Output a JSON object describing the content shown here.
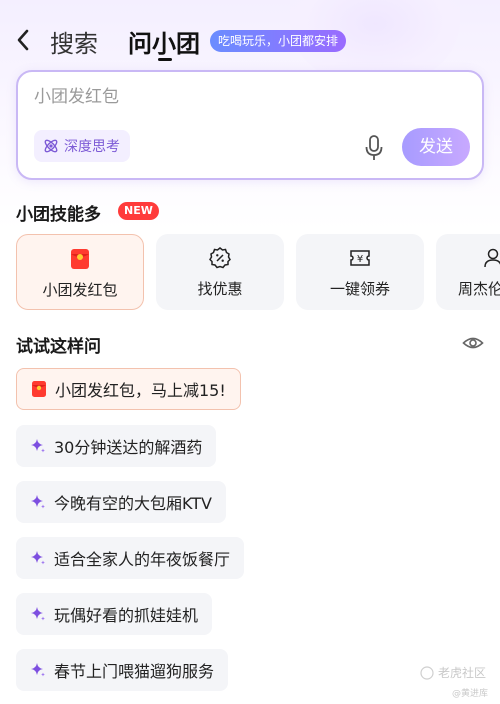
{
  "header": {
    "tab_search": "搜索",
    "tab_xiaotuan": "问小团",
    "slogan": "吃喝玩乐，小团都安排"
  },
  "input": {
    "placeholder": "小团发红包",
    "deep_think_label": "深度思考",
    "send_label": "发送"
  },
  "skills": {
    "title": "小团技能多",
    "new_badge": "NEW",
    "items": [
      {
        "label": "小团发红包",
        "icon": "red-packet-icon"
      },
      {
        "label": "找优惠",
        "icon": "discount-icon"
      },
      {
        "label": "一键领券",
        "icon": "coupon-icon"
      },
      {
        "label": "周杰伦",
        "icon": "person-icon"
      }
    ]
  },
  "try_asking": {
    "title": "试试这样问",
    "items": [
      {
        "text": "小团发红包，马上减15!",
        "icon": "red-packet-icon"
      },
      {
        "text": "30分钟送达的解酒药",
        "icon": "sparkle-icon"
      },
      {
        "text": "今晚有空的大包厢KTV",
        "icon": "sparkle-icon"
      },
      {
        "text": "适合全家人的年夜饭餐厅",
        "icon": "sparkle-icon"
      },
      {
        "text": "玩偶好看的抓娃娃机",
        "icon": "sparkle-icon"
      },
      {
        "text": "春节上门喂猫遛狗服务",
        "icon": "sparkle-icon"
      }
    ]
  },
  "watermark": {
    "text": "老虎社区",
    "sub": "@黄进库"
  },
  "colors": {
    "accent_purple": "#9a6bff",
    "send_bg": "#b3a1ff",
    "new_red": "#ff3b3b",
    "highlight_border": "#f3c2ae"
  }
}
